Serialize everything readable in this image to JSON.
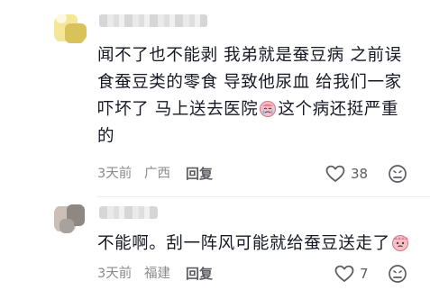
{
  "comments": [
    {
      "lines": [
        "闻不了也不能剥 我弟就是蚕豆病 之前误",
        "食蚕豆类的零食 导致他尿血 给我们一家",
        "吓坏了 马上送去医院",
        "这个病还挺严重",
        "的"
      ],
      "time": "3天前",
      "location": "广西",
      "reply_label": "回复",
      "like_count": "38"
    },
    {
      "text": "不能啊。刮一阵风可能就给蚕豆送走了",
      "time": "3天前",
      "location": "福建",
      "reply_label": "回复",
      "like_count": "7"
    }
  ],
  "colors": {
    "meta": "#8a8b91",
    "text": "#161823",
    "emoji": "#f4a7b3"
  },
  "icons": [
    "heart-outline-icon",
    "dislike-face-icon",
    "crying-emoji-icon",
    "teary-emoji-icon"
  ]
}
